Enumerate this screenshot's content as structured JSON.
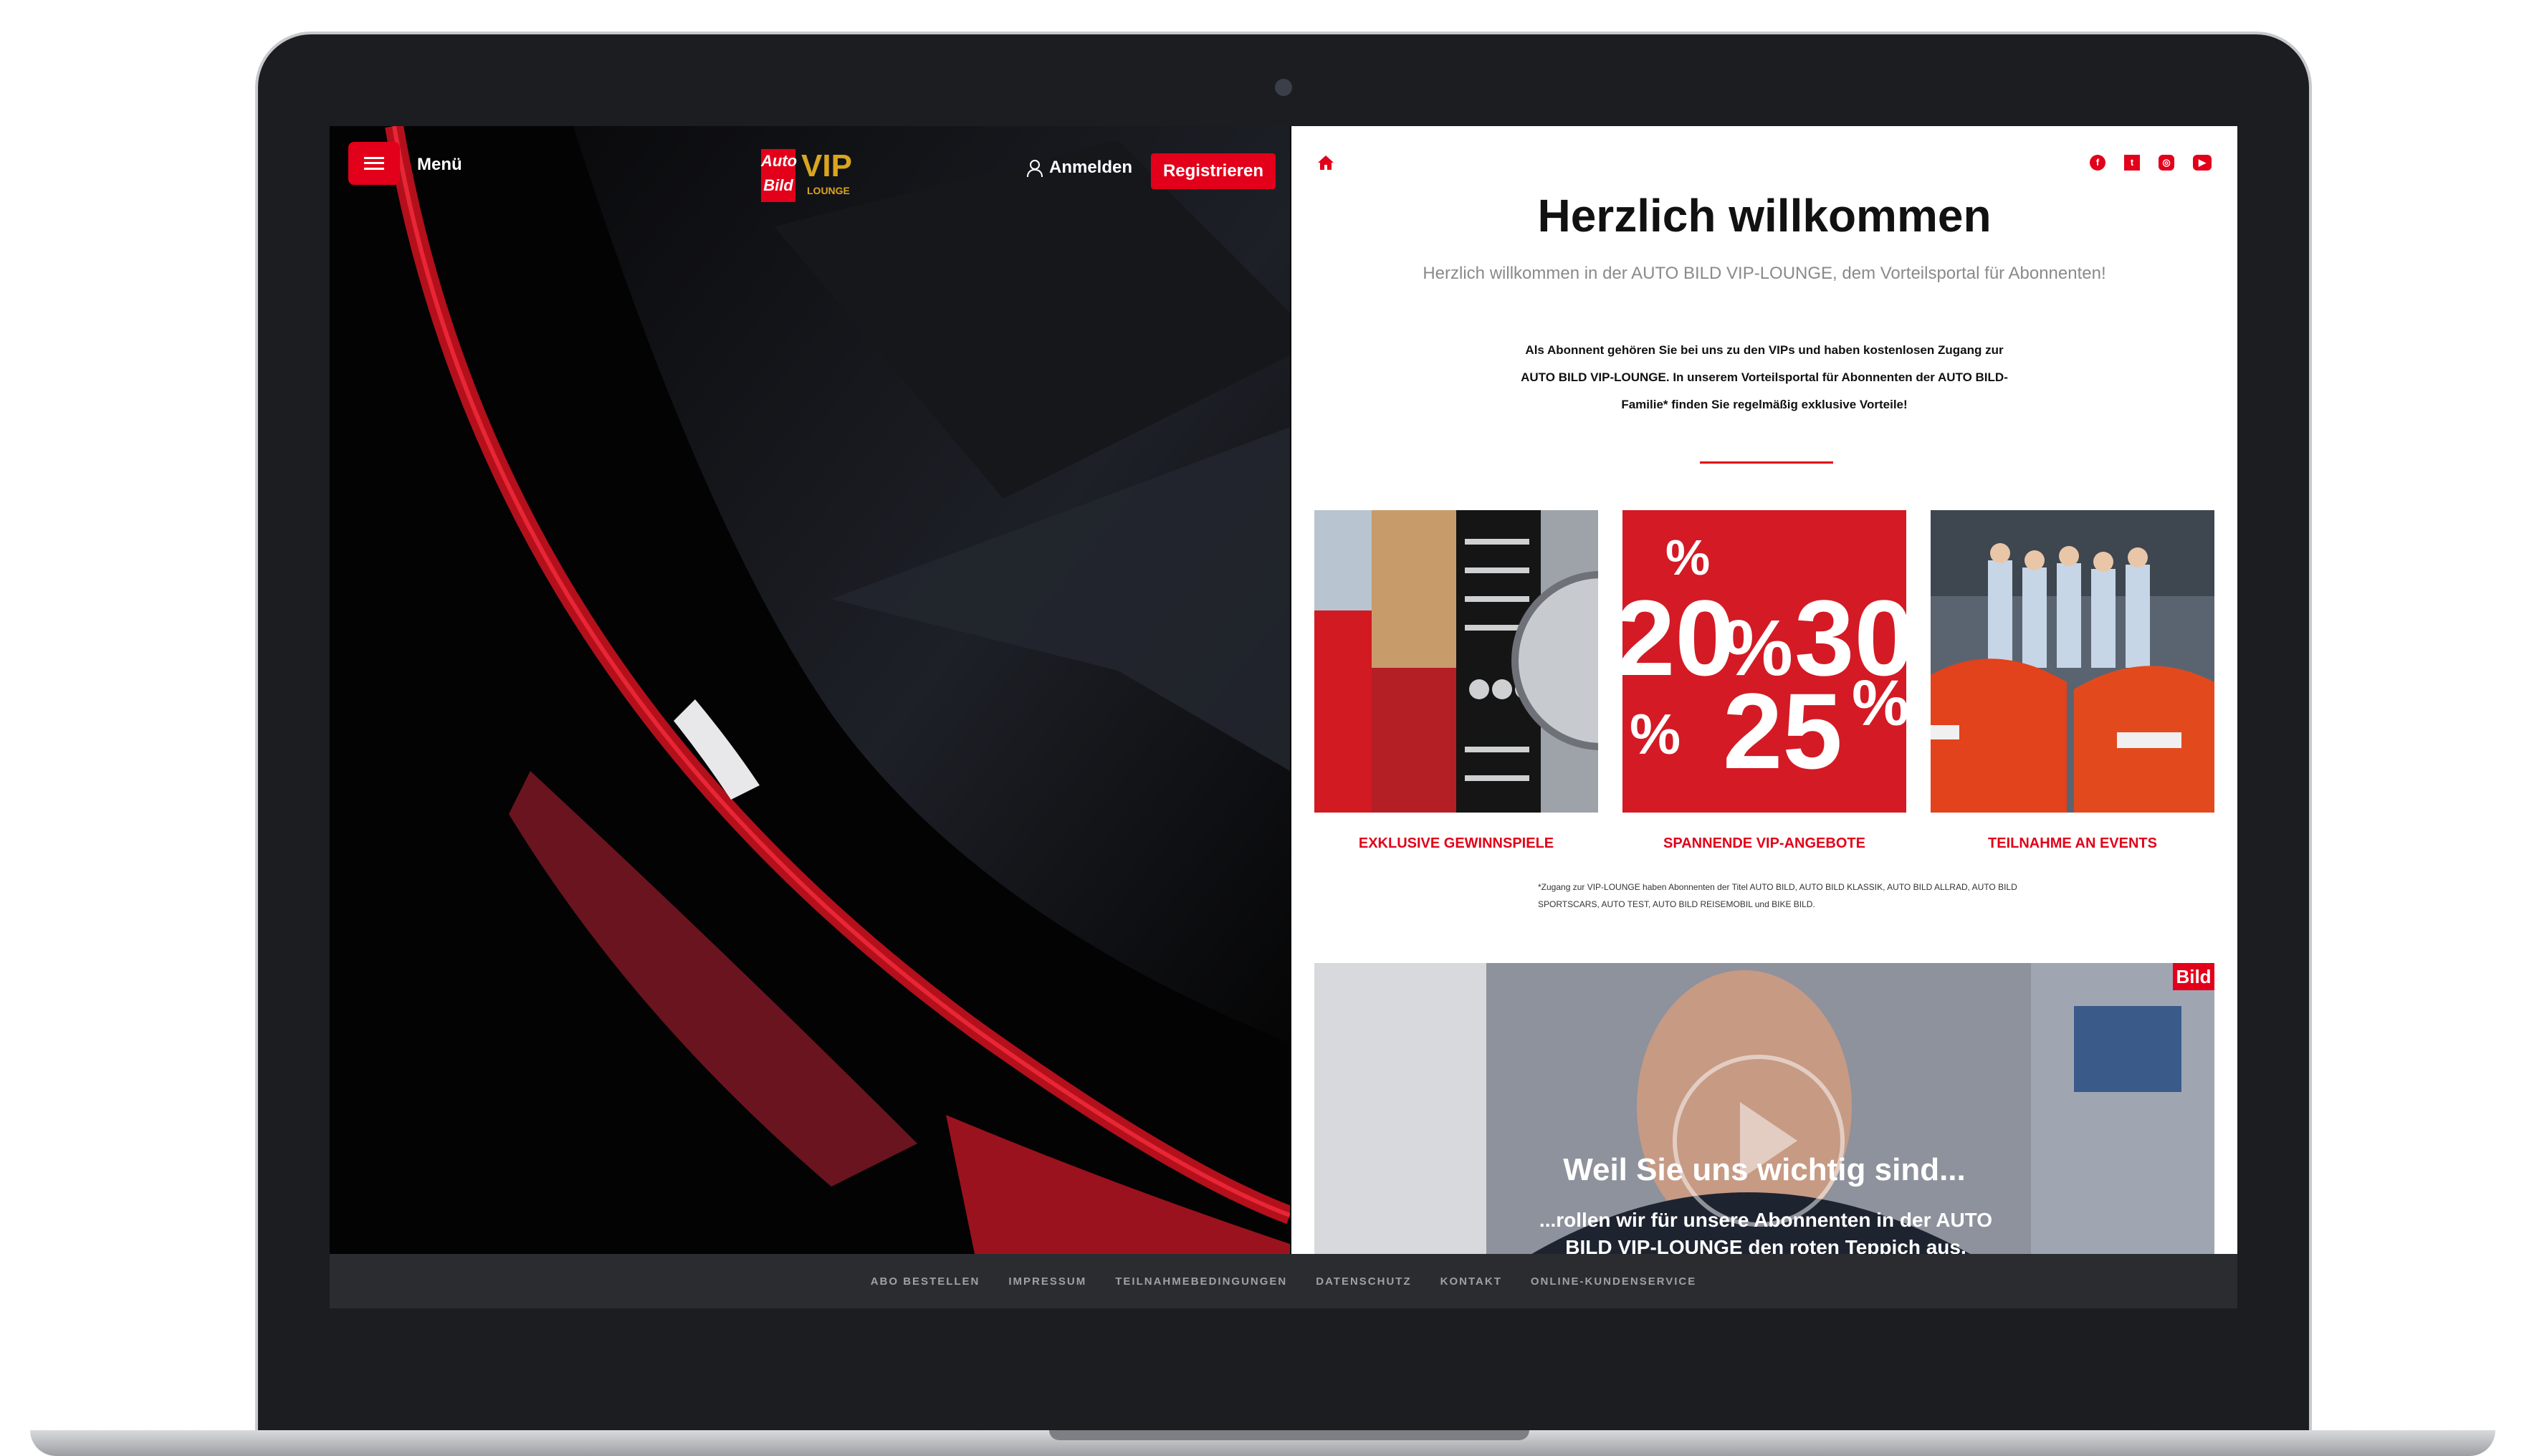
{
  "colors": {
    "brand_red": "#e2001a",
    "gold": "#d9a520",
    "footer_bg": "#2b2c30",
    "muted_text": "#8a8a8a"
  },
  "header": {
    "menu_icon": "hamburger-icon",
    "menu_label": "Menü",
    "logo": {
      "auto": "Auto",
      "bild": "Bild",
      "vip": "VIP",
      "lounge": "LOUNGE"
    },
    "login_icon": "user-icon",
    "login_label": "Anmelden",
    "register_label": "Registrieren"
  },
  "right_header": {
    "home_icon": "home-icon",
    "social": [
      "facebook-icon",
      "twitter-icon",
      "instagram-icon",
      "youtube-icon"
    ]
  },
  "welcome": {
    "title": "Herzlich willkommen",
    "subtitle": "Herzlich willkommen in der AUTO BILD VIP-LOUNGE, dem Vorteilsportal für Abonnenten!",
    "body": "Als Abonnent gehören Sie bei uns zu den VIPs und haben kostenlosen Zugang zur AUTO BILD VIP-LOUNGE. In unserem Vorteilsportal für Abonnenten der AUTO BILD-Familie* finden Sie regelmäßig exklusive Vorteile!"
  },
  "tiles": [
    {
      "label": "EXKLUSIVE GEWINNSPIELE"
    },
    {
      "label": "SPANNENDE VIP-ANGEBOTE",
      "numbers": [
        "%",
        "20",
        "%",
        "30",
        "%",
        "25",
        "%"
      ]
    },
    {
      "label": "TEILNAHME AN EVENTS"
    }
  ],
  "footnote": "*Zugang zur VIP-LOUNGE haben Abonnenten der Titel AUTO BILD, AUTO BILD KLASSIK, AUTO BILD ALLRAD, AUTO BILD SPORTSCARS, AUTO TEST, AUTO BILD REISEMOBIL und BIKE BILD.",
  "video": {
    "title": "Weil Sie uns wichtig sind...",
    "subtitle": "...rollen wir für unsere Abonnenten in der AUTO BILD VIP-LOUNGE den roten Teppich aus.",
    "badge": "Bild",
    "play_icon": "play-icon"
  },
  "footer_links": [
    "ABO BESTELLEN",
    "IMPRESSUM",
    "TEILNAHMEBEDINGUNGEN",
    "DATENSCHUTZ",
    "KONTAKT",
    "ONLINE-KUNDENSERVICE"
  ]
}
